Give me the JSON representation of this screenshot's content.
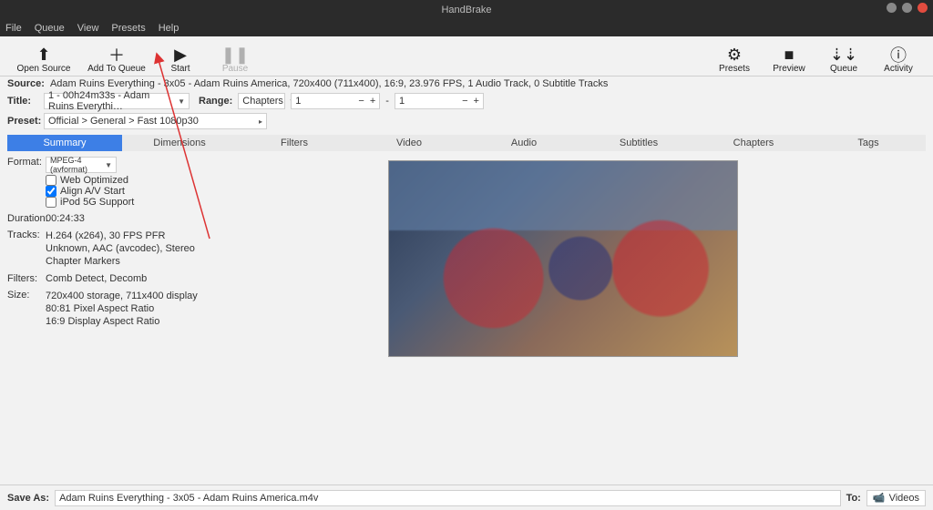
{
  "window": {
    "title": "HandBrake"
  },
  "menubar": [
    "File",
    "Queue",
    "View",
    "Presets",
    "Help"
  ],
  "toolbar_left": [
    {
      "name": "open-source",
      "icon": "⬆",
      "label": "Open Source"
    },
    {
      "name": "add-to-queue",
      "icon": "＋",
      "label": "Add To Queue"
    },
    {
      "name": "start",
      "icon": "▶",
      "label": "Start"
    },
    {
      "name": "pause",
      "icon": "❚❚",
      "label": "Pause",
      "disabled": true
    }
  ],
  "toolbar_right": [
    {
      "name": "presets",
      "icon": "⚙",
      "label": "Presets"
    },
    {
      "name": "preview",
      "icon": "■",
      "label": "Preview"
    },
    {
      "name": "queue",
      "icon": "⇣⇣",
      "label": "Queue"
    },
    {
      "name": "activity",
      "icon": "ⓘ",
      "label": "Activity"
    }
  ],
  "source": {
    "label": "Source:",
    "value": "Adam Ruins Everything - 3x05 - Adam Ruins America, 720x400 (711x400), 16:9, 23.976 FPS, 1 Audio Track, 0 Subtitle Tracks"
  },
  "title": {
    "label": "Title:",
    "value": "1 - 00h24m33s - Adam Ruins Everythi…"
  },
  "range": {
    "label": "Range:",
    "mode": "Chapters",
    "from": "1",
    "to": "1"
  },
  "preset": {
    "label": "Preset:",
    "value": "Official > General > Fast 1080p30"
  },
  "tabs": [
    "Summary",
    "Dimensions",
    "Filters",
    "Video",
    "Audio",
    "Subtitles",
    "Chapters",
    "Tags"
  ],
  "active_tab": "Summary",
  "format": {
    "label": "Format:",
    "value": "MPEG-4 (avformat)"
  },
  "checks": {
    "web_optimized": {
      "label": "Web Optimized",
      "checked": false
    },
    "align_av": {
      "label": "Align A/V Start",
      "checked": true
    },
    "ipod": {
      "label": "iPod 5G Support",
      "checked": false
    }
  },
  "duration": {
    "label": "Duration:",
    "value": "00:24:33"
  },
  "tracks": {
    "label": "Tracks:",
    "lines": [
      "H.264 (x264), 30 FPS PFR",
      "Unknown, AAC (avcodec), Stereo",
      "Chapter Markers"
    ]
  },
  "filters": {
    "label": "Filters:",
    "value": "Comb Detect, Decomb"
  },
  "size": {
    "label": "Size:",
    "lines": [
      "720x400 storage, 711x400 display",
      "80:81 Pixel Aspect Ratio",
      "16:9 Display Aspect Ratio"
    ]
  },
  "saveas": {
    "label": "Save As:",
    "value": "Adam Ruins Everything - 3x05 - Adam Ruins America.m4v",
    "to_label": "To:",
    "to_value": "Videos"
  }
}
